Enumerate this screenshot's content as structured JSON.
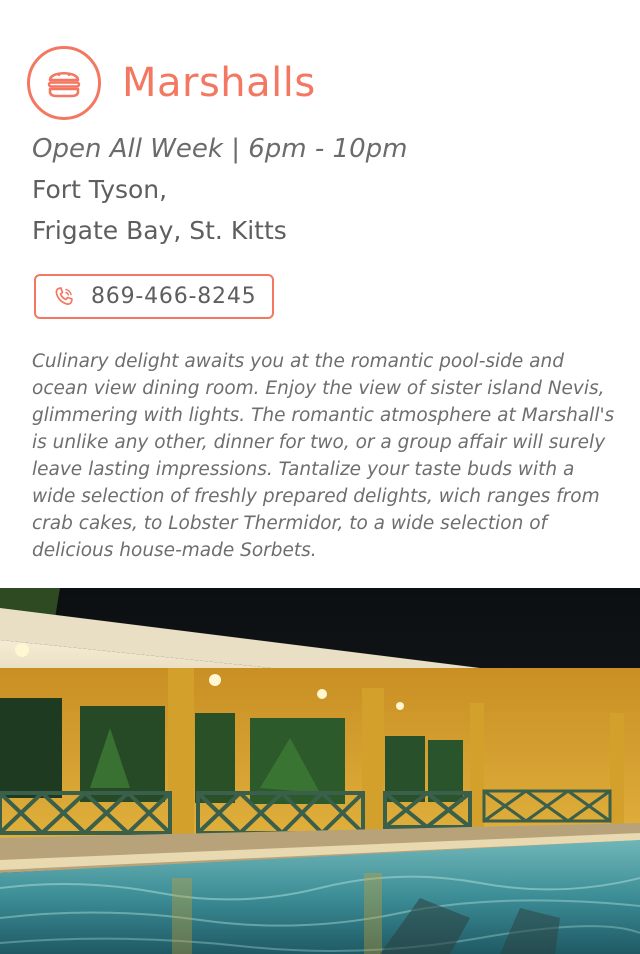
{
  "restaurant": {
    "name": "Marshalls",
    "hours": "Open All Week | 6pm - 10pm",
    "address_line1": "Fort Tyson,",
    "address_line2": "Frigate Bay, St. Kitts",
    "phone": "869-466-8245",
    "description": "Culinary delight awaits you at the romantic pool-side and ocean view dining room. Enjoy the view of sister island Nevis, glimmering with lights. The romantic atmosphere at Marshall's is unlike any other, dinner for two, or a group affair will surely leave lasting impressions. Tantalize your taste buds with a wide selection of freshly prepared delights, wich ranges from crab cakes, to Lobster Thermidor, to a wide selection of delicious house-made Sorbets."
  },
  "icons": {
    "logo": "burger-icon",
    "phone": "phone-icon"
  },
  "colors": {
    "accent": "#f47762",
    "text": "#5e5e5e",
    "wall": "#d9a531",
    "pool": "#3f8f9c"
  }
}
